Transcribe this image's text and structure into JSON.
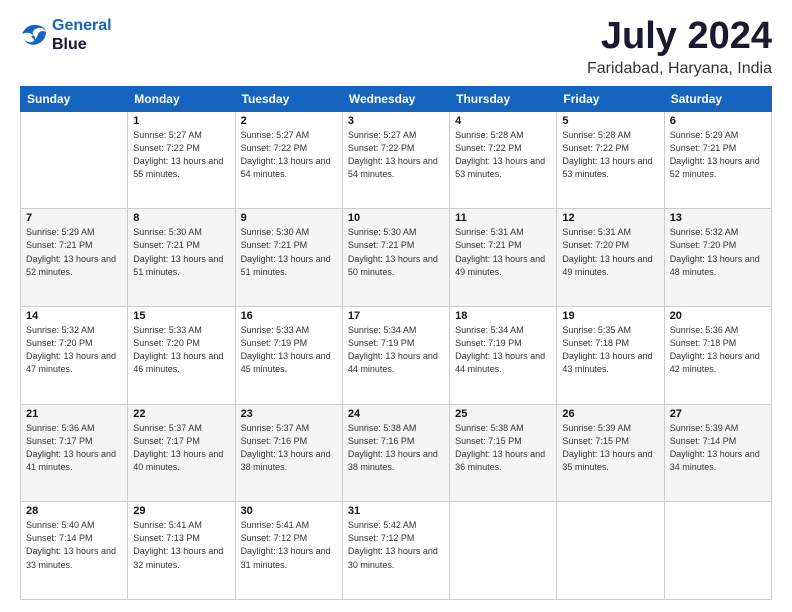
{
  "logo": {
    "line1": "General",
    "line2": "Blue"
  },
  "title": "July 2024",
  "subtitle": "Faridabad, Haryana, India",
  "days_of_week": [
    "Sunday",
    "Monday",
    "Tuesday",
    "Wednesday",
    "Thursday",
    "Friday",
    "Saturday"
  ],
  "weeks": [
    [
      {
        "day": "",
        "sunrise": "",
        "sunset": "",
        "daylight": ""
      },
      {
        "day": "1",
        "sunrise": "Sunrise: 5:27 AM",
        "sunset": "Sunset: 7:22 PM",
        "daylight": "Daylight: 13 hours and 55 minutes."
      },
      {
        "day": "2",
        "sunrise": "Sunrise: 5:27 AM",
        "sunset": "Sunset: 7:22 PM",
        "daylight": "Daylight: 13 hours and 54 minutes."
      },
      {
        "day": "3",
        "sunrise": "Sunrise: 5:27 AM",
        "sunset": "Sunset: 7:22 PM",
        "daylight": "Daylight: 13 hours and 54 minutes."
      },
      {
        "day": "4",
        "sunrise": "Sunrise: 5:28 AM",
        "sunset": "Sunset: 7:22 PM",
        "daylight": "Daylight: 13 hours and 53 minutes."
      },
      {
        "day": "5",
        "sunrise": "Sunrise: 5:28 AM",
        "sunset": "Sunset: 7:22 PM",
        "daylight": "Daylight: 13 hours and 53 minutes."
      },
      {
        "day": "6",
        "sunrise": "Sunrise: 5:29 AM",
        "sunset": "Sunset: 7:21 PM",
        "daylight": "Daylight: 13 hours and 52 minutes."
      }
    ],
    [
      {
        "day": "7",
        "sunrise": "Sunrise: 5:29 AM",
        "sunset": "Sunset: 7:21 PM",
        "daylight": "Daylight: 13 hours and 52 minutes."
      },
      {
        "day": "8",
        "sunrise": "Sunrise: 5:30 AM",
        "sunset": "Sunset: 7:21 PM",
        "daylight": "Daylight: 13 hours and 51 minutes."
      },
      {
        "day": "9",
        "sunrise": "Sunrise: 5:30 AM",
        "sunset": "Sunset: 7:21 PM",
        "daylight": "Daylight: 13 hours and 51 minutes."
      },
      {
        "day": "10",
        "sunrise": "Sunrise: 5:30 AM",
        "sunset": "Sunset: 7:21 PM",
        "daylight": "Daylight: 13 hours and 50 minutes."
      },
      {
        "day": "11",
        "sunrise": "Sunrise: 5:31 AM",
        "sunset": "Sunset: 7:21 PM",
        "daylight": "Daylight: 13 hours and 49 minutes."
      },
      {
        "day": "12",
        "sunrise": "Sunrise: 5:31 AM",
        "sunset": "Sunset: 7:20 PM",
        "daylight": "Daylight: 13 hours and 49 minutes."
      },
      {
        "day": "13",
        "sunrise": "Sunrise: 5:32 AM",
        "sunset": "Sunset: 7:20 PM",
        "daylight": "Daylight: 13 hours and 48 minutes."
      }
    ],
    [
      {
        "day": "14",
        "sunrise": "Sunrise: 5:32 AM",
        "sunset": "Sunset: 7:20 PM",
        "daylight": "Daylight: 13 hours and 47 minutes."
      },
      {
        "day": "15",
        "sunrise": "Sunrise: 5:33 AM",
        "sunset": "Sunset: 7:20 PM",
        "daylight": "Daylight: 13 hours and 46 minutes."
      },
      {
        "day": "16",
        "sunrise": "Sunrise: 5:33 AM",
        "sunset": "Sunset: 7:19 PM",
        "daylight": "Daylight: 13 hours and 45 minutes."
      },
      {
        "day": "17",
        "sunrise": "Sunrise: 5:34 AM",
        "sunset": "Sunset: 7:19 PM",
        "daylight": "Daylight: 13 hours and 44 minutes."
      },
      {
        "day": "18",
        "sunrise": "Sunrise: 5:34 AM",
        "sunset": "Sunset: 7:19 PM",
        "daylight": "Daylight: 13 hours and 44 minutes."
      },
      {
        "day": "19",
        "sunrise": "Sunrise: 5:35 AM",
        "sunset": "Sunset: 7:18 PM",
        "daylight": "Daylight: 13 hours and 43 minutes."
      },
      {
        "day": "20",
        "sunrise": "Sunrise: 5:36 AM",
        "sunset": "Sunset: 7:18 PM",
        "daylight": "Daylight: 13 hours and 42 minutes."
      }
    ],
    [
      {
        "day": "21",
        "sunrise": "Sunrise: 5:36 AM",
        "sunset": "Sunset: 7:17 PM",
        "daylight": "Daylight: 13 hours and 41 minutes."
      },
      {
        "day": "22",
        "sunrise": "Sunrise: 5:37 AM",
        "sunset": "Sunset: 7:17 PM",
        "daylight": "Daylight: 13 hours and 40 minutes."
      },
      {
        "day": "23",
        "sunrise": "Sunrise: 5:37 AM",
        "sunset": "Sunset: 7:16 PM",
        "daylight": "Daylight: 13 hours and 38 minutes."
      },
      {
        "day": "24",
        "sunrise": "Sunrise: 5:38 AM",
        "sunset": "Sunset: 7:16 PM",
        "daylight": "Daylight: 13 hours and 38 minutes."
      },
      {
        "day": "25",
        "sunrise": "Sunrise: 5:38 AM",
        "sunset": "Sunset: 7:15 PM",
        "daylight": "Daylight: 13 hours and 36 minutes."
      },
      {
        "day": "26",
        "sunrise": "Sunrise: 5:39 AM",
        "sunset": "Sunset: 7:15 PM",
        "daylight": "Daylight: 13 hours and 35 minutes."
      },
      {
        "day": "27",
        "sunrise": "Sunrise: 5:39 AM",
        "sunset": "Sunset: 7:14 PM",
        "daylight": "Daylight: 13 hours and 34 minutes."
      }
    ],
    [
      {
        "day": "28",
        "sunrise": "Sunrise: 5:40 AM",
        "sunset": "Sunset: 7:14 PM",
        "daylight": "Daylight: 13 hours and 33 minutes."
      },
      {
        "day": "29",
        "sunrise": "Sunrise: 5:41 AM",
        "sunset": "Sunset: 7:13 PM",
        "daylight": "Daylight: 13 hours and 32 minutes."
      },
      {
        "day": "30",
        "sunrise": "Sunrise: 5:41 AM",
        "sunset": "Sunset: 7:12 PM",
        "daylight": "Daylight: 13 hours and 31 minutes."
      },
      {
        "day": "31",
        "sunrise": "Sunrise: 5:42 AM",
        "sunset": "Sunset: 7:12 PM",
        "daylight": "Daylight: 13 hours and 30 minutes."
      },
      {
        "day": "",
        "sunrise": "",
        "sunset": "",
        "daylight": ""
      },
      {
        "day": "",
        "sunrise": "",
        "sunset": "",
        "daylight": ""
      },
      {
        "day": "",
        "sunrise": "",
        "sunset": "",
        "daylight": ""
      }
    ]
  ]
}
